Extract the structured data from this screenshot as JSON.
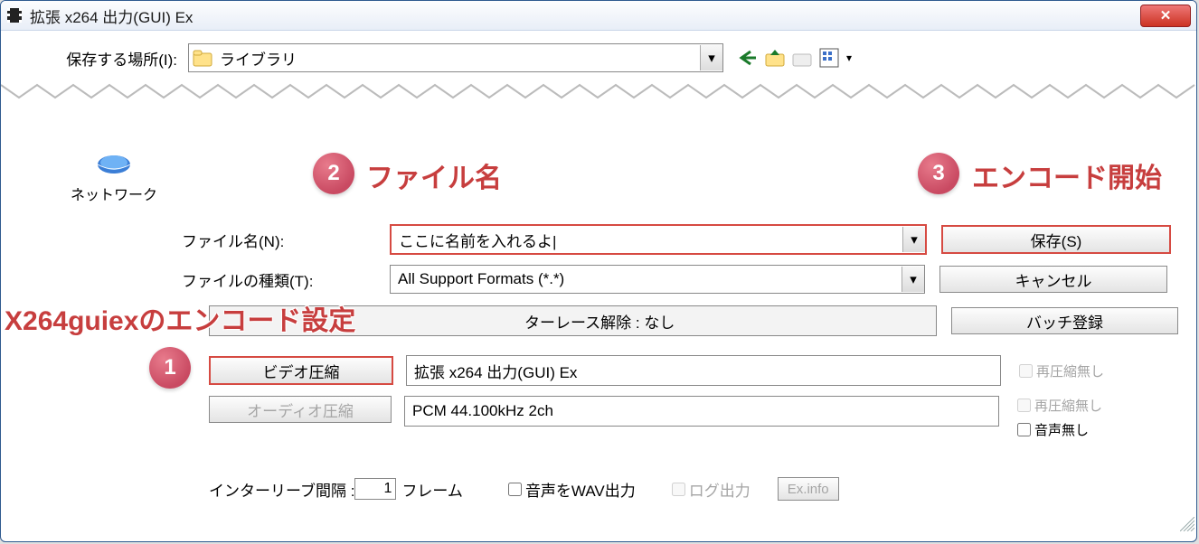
{
  "title": "拡張 x264 出力(GUI) Ex",
  "save_location_label": "保存する場所(I):",
  "save_location_value": "ライブラリ",
  "network_label": "ネットワーク",
  "filename_label": "ファイル名(N):",
  "filename_value": "ここに名前を入れるよ|",
  "filetype_label": "ファイルの種類(T):",
  "filetype_value": "All Support Formats (*.*)",
  "save_btn": "保存(S)",
  "cancel_btn": "キャンセル",
  "batch_btn": "バッチ登録",
  "interlace_text": "ターレース解除 : なし",
  "video_comp_btn": "ビデオ圧縮",
  "video_codec_value": "拡張 x264 出力(GUI) Ex",
  "audio_comp_btn": "オーディオ圧縮",
  "audio_codec_value": "PCM 44.100kHz 2ch",
  "recomp_none_label": "再圧縮無し",
  "audio_none_label": "音声無し",
  "interleave_label": "インターリーブ間隔 :",
  "interleave_value": "1",
  "interleave_unit": "フレーム",
  "audio_wav_label": "音声をWAV出力",
  "log_output_label": "ログ出力",
  "exinfo_btn": "Ex.info",
  "callouts": {
    "c1_text": "X264guiexのエンコード設定",
    "c2_text": "ファイル名",
    "c3_text": "エンコード開始"
  }
}
